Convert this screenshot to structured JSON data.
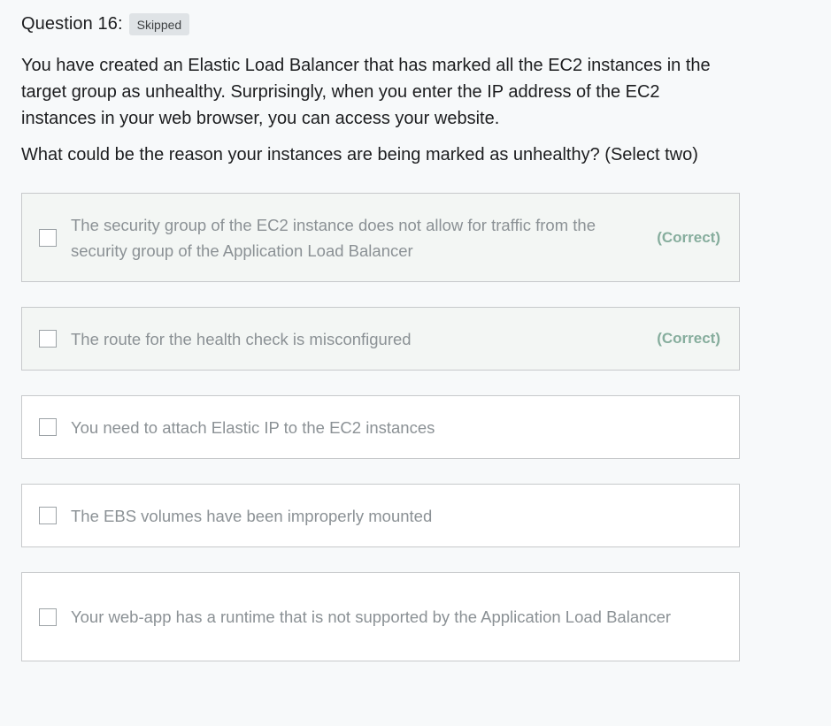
{
  "question": {
    "label": "Question 16:",
    "status_badge": "Skipped",
    "prompt_p1": "You have created an Elastic Load Balancer that has marked all the EC2 instances in the target group as unhealthy. Surprisingly, when you enter the IP address of the EC2 instances in your web browser, you can access your website.",
    "prompt_p2": "What could be the reason your instances are being marked as unhealthy? (Select two)"
  },
  "answers": [
    {
      "text": "The security group of the EC2 instance does not allow for traffic from the security group of the Application Load Balancer",
      "tag": "(Correct)",
      "checked": false
    },
    {
      "text": "The route for the health check is misconfigured",
      "tag": "(Correct)",
      "checked": false
    },
    {
      "text": "You need to attach Elastic IP to the EC2 instances",
      "tag": "",
      "checked": false
    },
    {
      "text": "The EBS volumes have been improperly mounted",
      "tag": "",
      "checked": false
    },
    {
      "text": "Your web-app has a runtime that is not supported by the Application Load Balancer",
      "tag": "",
      "checked": false
    }
  ],
  "colors": {
    "page_background": "#f7f9fa",
    "correct_background": "#f3f6f4",
    "correct_tag": "#86ad9d",
    "answer_text": "#8b9195",
    "badge_background": "#dfe3e6"
  },
  "icons": {
    "answer_checkbox": "checkbox-unchecked-icon"
  }
}
